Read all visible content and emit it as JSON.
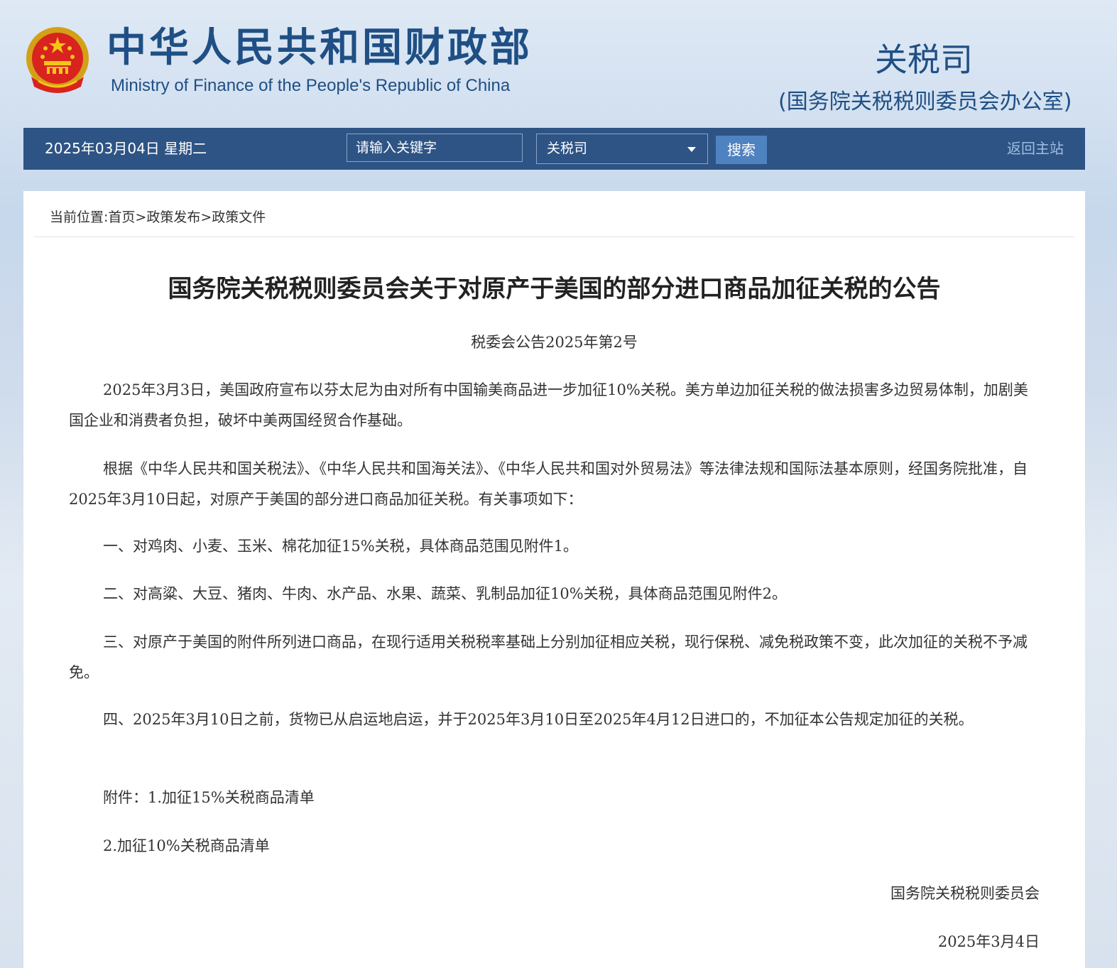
{
  "header": {
    "site_title": "中华人民共和国财政部",
    "site_subtitle": "Ministry of Finance of the People's Republic of China",
    "dept_title": "关税司",
    "dept_subtitle": "(国务院关税税则委员会办公室)"
  },
  "navbar": {
    "date": "2025年03月04日  星期二",
    "search_placeholder": "请输入关键字",
    "search_value": "",
    "scope_selected": "关税司",
    "search_button": "搜索",
    "home_link": "返回主站"
  },
  "breadcrumb": {
    "prefix": "当前位置:",
    "items": [
      "首页",
      "政策发布",
      "政策文件"
    ],
    "separator": ">"
  },
  "article": {
    "title": "国务院关税税则委员会关于对原产于美国的部分进口商品加征关税的公告",
    "number": "税委会公告2025年第2号",
    "paragraphs": [
      "2025年3月3日，美国政府宣布以芬太尼为由对所有中国输美商品进一步加征10%关税。美方单边加征关税的做法损害多边贸易体制，加剧美国企业和消费者负担，破坏中美两国经贸合作基础。",
      "根据《中华人民共和国关税法》、《中华人民共和国海关法》、《中华人民共和国对外贸易法》等法律法规和国际法基本原则，经国务院批准，自2025年3月10日起，对原产于美国的部分进口商品加征关税。有关事项如下：",
      "一、对鸡肉、小麦、玉米、棉花加征15%关税，具体商品范围见附件1。",
      "二、对高粱、大豆、猪肉、牛肉、水产品、水果、蔬菜、乳制品加征10%关税，具体商品范围见附件2。",
      "三、对原产于美国的附件所列进口商品，在现行适用关税税率基础上分别加征相应关税，现行保税、减免税政策不变，此次加征的关税不予减免。",
      "四、2025年3月10日之前，货物已从启运地启运，并于2025年3月10日至2025年4月12日进口的，不加征本公告规定加征的关税。"
    ],
    "attachment_1": "附件：1.加征15%关税商品清单",
    "attachment_2": "2.加征10%关税商品清单",
    "signature": "国务院关税税则委员会",
    "sign_date": "2025年3月4日"
  },
  "colors": {
    "brand_blue": "#1f4f84",
    "navbar_bg": "#2e5485",
    "search_button_bg": "#4f82c0",
    "home_link": "#9dbde3"
  }
}
